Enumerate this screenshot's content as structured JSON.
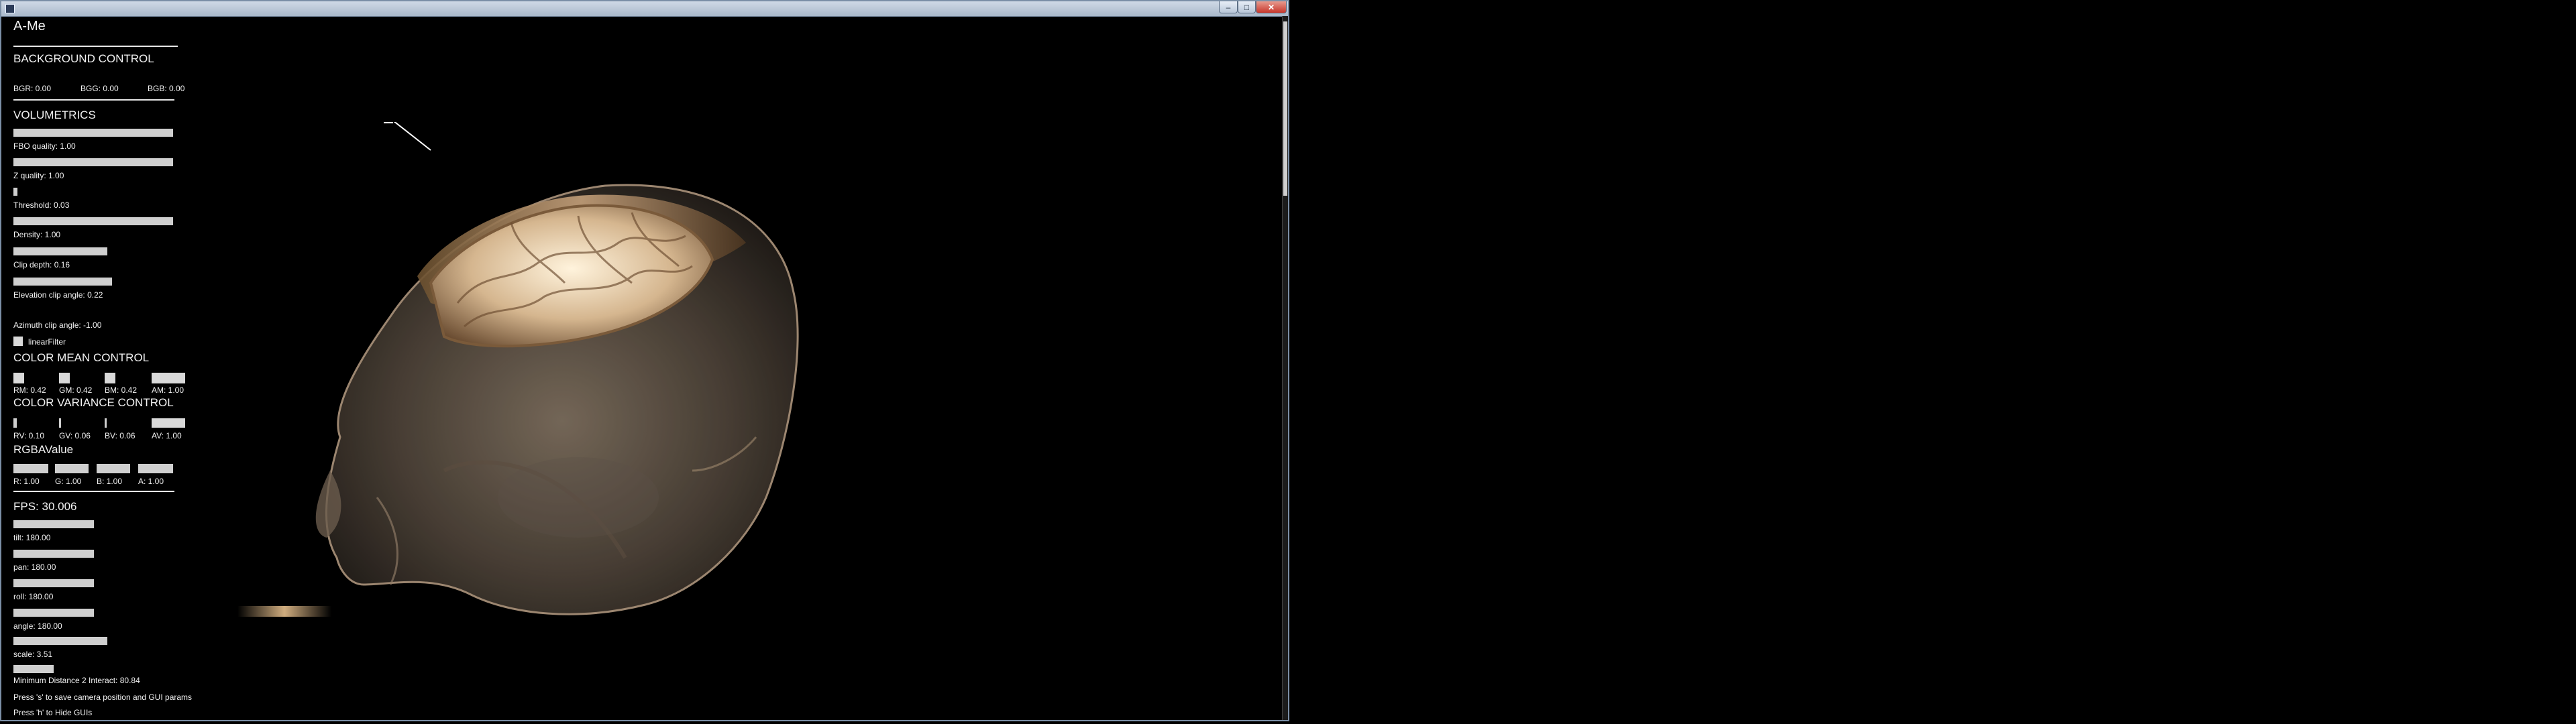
{
  "window": {
    "controls": {
      "minimize": "–",
      "maximize": "□",
      "close": "✕"
    }
  },
  "gui": {
    "app_title": "A-Me",
    "background": {
      "header": "BACKGROUND CONTROL",
      "labels": [
        "BGR: 0.00",
        "BGG: 0.00",
        "BGB: 0.00"
      ]
    },
    "volumetrics": {
      "header": "VOLUMETRICS",
      "sliders": [
        {
          "label": "FBO quality: 1.00",
          "value": 1.0
        },
        {
          "label": "Z quality: 1.00",
          "value": 1.0
        },
        {
          "label": "Threshold: 0.03",
          "value": 0.03
        },
        {
          "label": "Density: 1.00",
          "value": 1.0
        },
        {
          "label": "Clip depth: 0.16",
          "value": 0.16
        },
        {
          "label": "Elevation clip angle: 0.22",
          "value": 0.22
        },
        {
          "label": "Azimuth clip angle: -1.00",
          "value": -1.0
        }
      ],
      "checkbox_label": "linearFilter"
    },
    "color_mean": {
      "header": "COLOR MEAN CONTROL",
      "labels": [
        "RM: 0.42",
        "GM: 0.42",
        "BM: 0.42",
        "AM: 1.00"
      ],
      "values": [
        0.42,
        0.42,
        0.42,
        1.0
      ]
    },
    "color_variance": {
      "header": "COLOR VARIANCE CONTROL",
      "labels": [
        "RV: 0.10",
        "GV: 0.06",
        "BV: 0.06",
        "AV: 1.00"
      ],
      "values": [
        0.1,
        0.06,
        0.06,
        1.0
      ]
    },
    "rgba": {
      "header": "RGBAValue",
      "labels": [
        "R: 1.00",
        "G: 1.00",
        "B: 1.00",
        "A: 1.00"
      ],
      "values": [
        1.0,
        1.0,
        1.0,
        1.0
      ]
    },
    "fps": "FPS: 30.006",
    "camera": [
      {
        "label": "tilt: 180.00",
        "value": 180.0
      },
      {
        "label": "pan: 180.00",
        "value": 180.0
      },
      {
        "label": "roll: 180.00",
        "value": 180.0
      },
      {
        "label": "angle: 180.00",
        "value": 180.0
      },
      {
        "label": "scale: 3.51",
        "value": 3.51
      }
    ],
    "footer": [
      "Minimum Distance 2 Interact: 80.84",
      "Press 's' to save camera position and GUI params",
      "Press 'h' to Hide GUIs"
    ]
  },
  "colors": {
    "background": "#000000",
    "gui_text": "#f2f2f2",
    "slider": "#cfcfcf",
    "frame": "#7b8fa6",
    "close_button": "#c7372c"
  }
}
